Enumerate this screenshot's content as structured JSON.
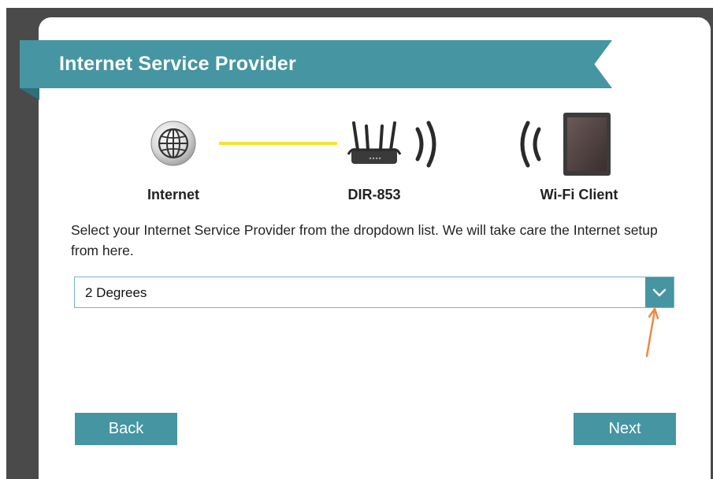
{
  "header": {
    "title": "Internet Service Provider"
  },
  "diagram": {
    "internet_label": "Internet",
    "router_label": "DIR-853",
    "client_label": "Wi-Fi Client",
    "link_color": "#f2e433"
  },
  "instructions": "Select your Internet Service Provider from the dropdown list. We will take care the Internet setup from here.",
  "isp_select": {
    "value": "2 Degrees"
  },
  "buttons": {
    "back": "Back",
    "next": "Next"
  },
  "colors": {
    "accent": "#4595a3",
    "annotation_arrow": "#f08a3c"
  }
}
